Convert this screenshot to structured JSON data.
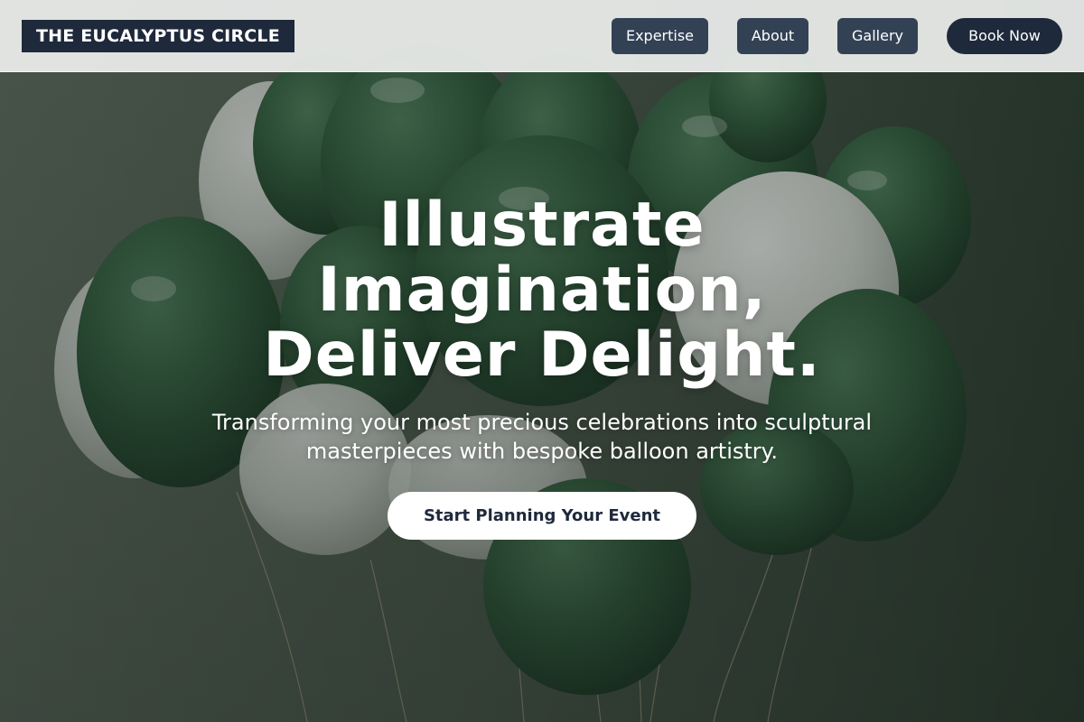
{
  "brand": {
    "name": "THE EUCALYPTUS CIRCLE"
  },
  "nav": {
    "items": [
      {
        "label": "Expertise"
      },
      {
        "label": "About"
      },
      {
        "label": "Gallery"
      }
    ],
    "cta_label": "Book Now"
  },
  "hero": {
    "title_lines": [
      "Illustrate",
      "Imagination,",
      "Deliver Delight."
    ],
    "subtitle_lines": [
      "Transforming your most precious celebrations into sculptural",
      "masterpieces with bespoke balloon artistry."
    ],
    "cta_label": "Start Planning Your Event",
    "background_image": "green and white balloons"
  },
  "colors": {
    "brand_dark": "#1e293b",
    "nav_button": "#334155",
    "balloon_green": "#2f5a3c",
    "balloon_white": "#d8dcd8",
    "background": "#3c4a3f"
  }
}
